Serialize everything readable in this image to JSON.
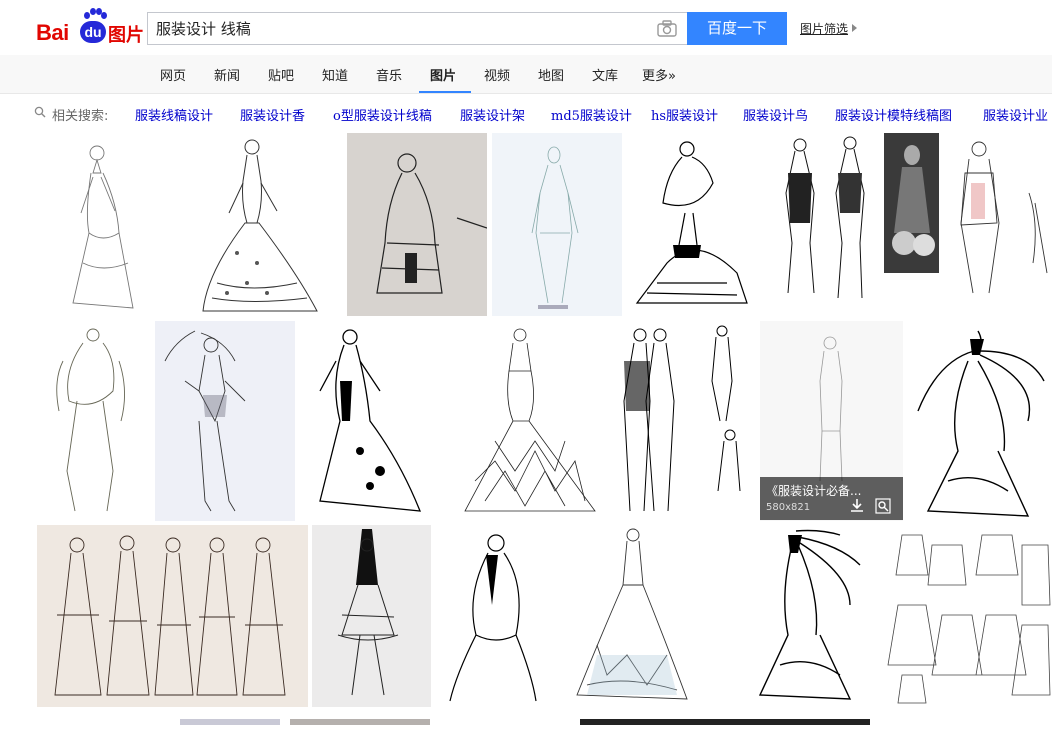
{
  "logo": {
    "bai": "Bai",
    "du": "du",
    "tu": "图片"
  },
  "search": {
    "value": "服装设计 线稿",
    "button_label": "百度一下",
    "filter_label": "图片筛选"
  },
  "nav": {
    "tabs": [
      "网页",
      "新闻",
      "贴吧",
      "知道",
      "音乐",
      "图片",
      "视频",
      "地图",
      "文库",
      "更多»"
    ],
    "active": "图片"
  },
  "related": {
    "label": "相关搜索:",
    "links": [
      "服装线稿设计",
      "服装设计香",
      "o型服装设计线稿",
      "服装设计架",
      "md5服装设计",
      "hs服装设计",
      "服装设计鸟",
      "服装设计模特线稿图",
      "服装设计业"
    ]
  },
  "hover_card": {
    "title": "《服装设计必备...",
    "size": "580x821"
  },
  "colors": {
    "brand_red": "#e10601",
    "brand_blue": "#2529d8",
    "button_blue": "#3385ff",
    "link_blue": "#0000cc"
  }
}
